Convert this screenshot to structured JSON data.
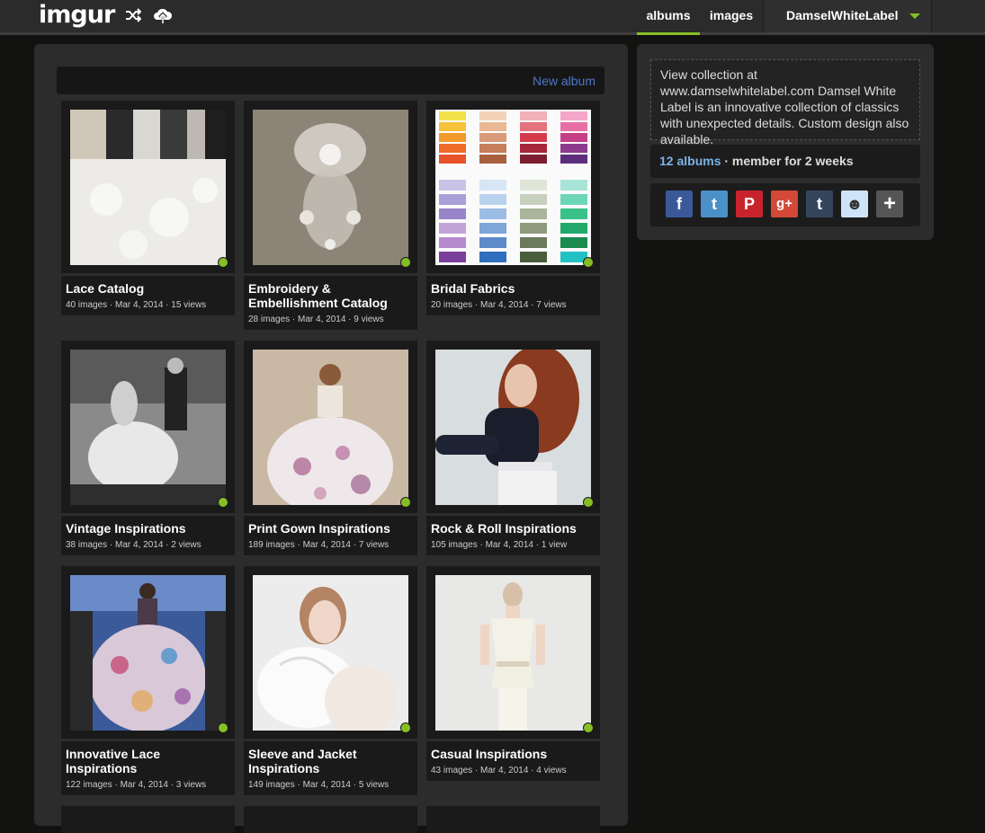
{
  "header": {
    "logo": "imgur",
    "nav": {
      "albums": "albums",
      "images": "images",
      "user": "DamselWhiteLabel"
    },
    "icons": [
      "random-icon",
      "upload-icon",
      "chevron-down-icon"
    ]
  },
  "albums_panel": {
    "new_album": "New album",
    "albums": [
      {
        "title": "Lace Catalog",
        "meta": "40 images · Mar 4, 2014 · 15 views"
      },
      {
        "title": "Embroidery & Embellishment Catalog",
        "meta": "28 images · Mar 4, 2014 · 9 views"
      },
      {
        "title": "Bridal Fabrics",
        "meta": "20 images · Mar 4, 2014 · 7 views"
      },
      {
        "title": "Vintage Inspirations",
        "meta": "38 images · Mar 4, 2014 · 2 views"
      },
      {
        "title": "Print Gown Inspirations",
        "meta": "189 images · Mar 4, 2014 · 7 views"
      },
      {
        "title": "Rock & Roll Inspirations",
        "meta": "105 images · Mar 4, 2014 · 1 view"
      },
      {
        "title": "Innovative Lace Inspirations",
        "meta": "122 images · Mar 4, 2014 · 3 views"
      },
      {
        "title": "Sleeve and Jacket Inspirations",
        "meta": "149 images · Mar 4, 2014 · 5 views"
      },
      {
        "title": "Casual Inspirations",
        "meta": "43 images · Mar 4, 2014 · 4 views"
      }
    ]
  },
  "sidebar": {
    "bio": "View collection at www.damselwhitelabel.com Damsel White Label is an innovative collection of classics with unexpected details. Custom design also available.",
    "stats_count": "12 albums",
    "stats_rest": " · member for 2 weeks",
    "share": [
      {
        "name": "facebook-icon",
        "glyph": "f",
        "color": "#3b5998"
      },
      {
        "name": "twitter-icon",
        "glyph": "t",
        "color": "#4a90c9"
      },
      {
        "name": "pinterest-icon",
        "glyph": "P",
        "color": "#c8232c"
      },
      {
        "name": "google-plus-icon",
        "glyph": "g+",
        "color": "#d34836"
      },
      {
        "name": "tumblr-icon",
        "glyph": "t",
        "color": "#35465c"
      },
      {
        "name": "reddit-icon",
        "glyph": "☻",
        "color": "#cee3f8"
      },
      {
        "name": "more-share-icon",
        "glyph": "+",
        "color": "#555555"
      }
    ]
  },
  "colors": {
    "accent_green": "#85bf25",
    "link_blue": "#4e76c9",
    "stat_blue": "#7ab3e8"
  }
}
